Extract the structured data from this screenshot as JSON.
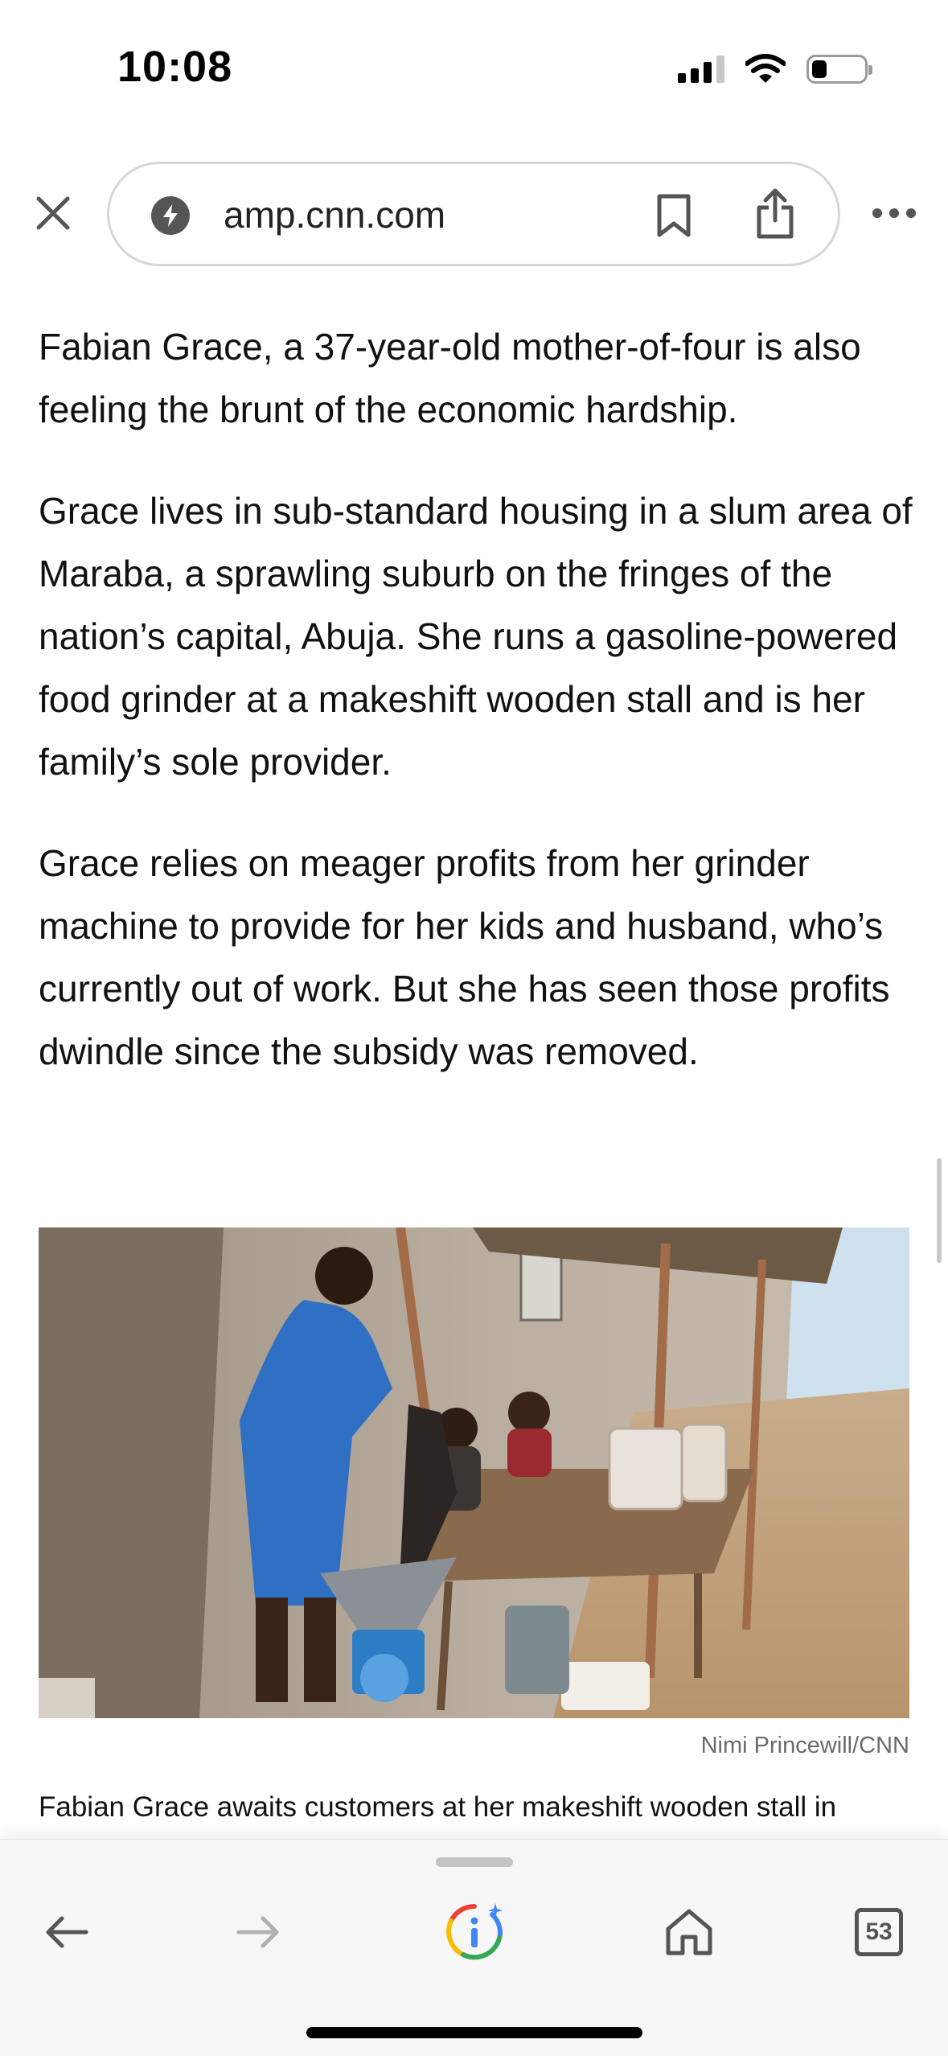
{
  "status_bar": {
    "time": "10:08",
    "icons": [
      "cellular-signal-icon",
      "wifi-icon",
      "battery-icon"
    ]
  },
  "browser": {
    "url": "amp.cnn.com",
    "icons": [
      "close-icon",
      "amp-lightning-icon",
      "bookmark-icon",
      "share-icon",
      "more-icon"
    ]
  },
  "article": {
    "paragraphs": [
      "Fabian Grace, a 37-year-old mother-of-four is also feeling the brunt of the economic hardship.",
      "Grace lives in sub-standard housing in a slum area of Maraba, a sprawling suburb on the fringes of the nation’s capital, Abuja. She runs a gasoline-powered food grinder at a makeshift wooden stall and is her family’s sole provider.",
      "Grace relies on meager profits from her grinder machine to provide for her kids and husband, who’s currently out of work. But she has seen those profits dwindle since the subsidy was removed."
    ],
    "image_credit": "Nimi Princewill/CNN",
    "caption": "Fabian Grace awaits customers at her makeshift wooden stall in"
  },
  "bottom_bar": {
    "tab_count": "53",
    "icons": [
      "back-arrow-icon",
      "forward-arrow-icon",
      "google-lens-info-icon",
      "home-icon",
      "tabs-icon"
    ]
  },
  "colors": {
    "text": "#111111",
    "muted": "#6b6b6b",
    "toolbar_icon": "#555555",
    "forward_disabled": "#b0b0b0"
  }
}
